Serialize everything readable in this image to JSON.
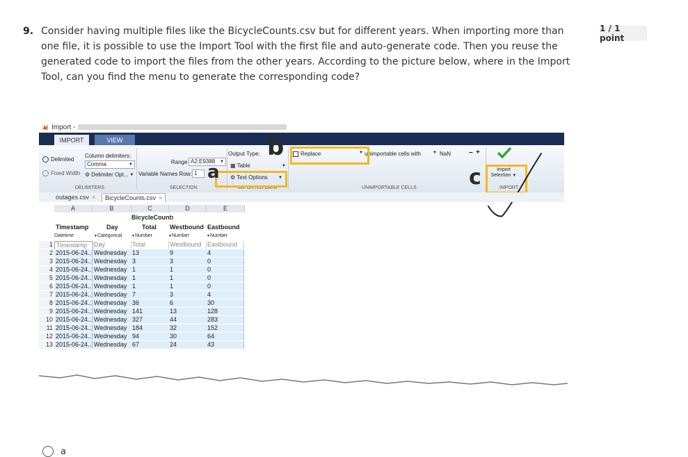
{
  "question": {
    "number": "9.",
    "text": "Consider having multiple files like the BicycleCounts.csv but for different years. When importing more than one file, it is possible to use the Import Tool with the first file and auto-generate code. Then you reuse the generated code to import the files from the other years. According to the picture below, where in the Import Tool, can you find the menu to generate the corresponding code?",
    "points": "1 / 1 point"
  },
  "screenshot": {
    "window_title": "Import -",
    "tabs": [
      "IMPORT",
      "VIEW"
    ],
    "ribbon": {
      "delimited_label": "Delimited",
      "fixed_width_label": "Fixed Width",
      "column_delimiters_label": "Column delimiters:",
      "delimiter_value": "Comma",
      "delimiter_options": "Delimiter Opt...",
      "range_label": "Range",
      "range_value": "A2:E9388",
      "variable_names_row_label": "Variable Names Row:",
      "variable_names_row_value": "1",
      "output_type_label": "Output Type:",
      "output_type_value": "Table",
      "text_options": "Text Options",
      "replace_label": "Replace",
      "unimportable_label": "unimportable cells with",
      "nan_value": "NaN",
      "import_selection": "Import Selection",
      "groups": {
        "delimiters": "DELIMITERS",
        "selection": "SELECTION",
        "imported_data": "IMPORTED DATA",
        "unimportable_cells": "UNIMPORTABLE CELLS",
        "import": "IMPORT"
      }
    },
    "annotations": {
      "a": "a",
      "b": "b",
      "c": "c"
    },
    "file_tabs": [
      "outages.csv",
      "BicycleCounts.csv"
    ],
    "grid": {
      "column_letters": [
        "A",
        "B",
        "C",
        "D",
        "E"
      ],
      "table_name": "BicycleCounts",
      "headers": [
        "Timestamp",
        "Day",
        "Total",
        "Westbound",
        "Eastbound"
      ],
      "types": [
        "Datetime",
        "Categorical",
        "Number",
        "Number",
        "Number"
      ],
      "name_row": [
        "Timestamp",
        "Day",
        "Total",
        "Westbound",
        "Eastbound"
      ],
      "rows": [
        {
          "n": "2",
          "ts": "2015-06-24...",
          "day": "Wednesday",
          "total": "13",
          "west": "9",
          "east": "4"
        },
        {
          "n": "3",
          "ts": "2015-06-24...",
          "day": "Wednesday",
          "total": "3",
          "west": "3",
          "east": "0"
        },
        {
          "n": "4",
          "ts": "2015-06-24...",
          "day": "Wednesday",
          "total": "1",
          "west": "1",
          "east": "0"
        },
        {
          "n": "5",
          "ts": "2015-06-24...",
          "day": "Wednesday",
          "total": "1",
          "west": "1",
          "east": "0"
        },
        {
          "n": "6",
          "ts": "2015-06-24...",
          "day": "Wednesday",
          "total": "1",
          "west": "1",
          "east": "0"
        },
        {
          "n": "7",
          "ts": "2015-06-24...",
          "day": "Wednesday",
          "total": "7",
          "west": "3",
          "east": "4"
        },
        {
          "n": "8",
          "ts": "2015-06-24...",
          "day": "Wednesday",
          "total": "36",
          "west": "6",
          "east": "30"
        },
        {
          "n": "9",
          "ts": "2015-06-24...",
          "day": "Wednesday",
          "total": "141",
          "west": "13",
          "east": "128"
        },
        {
          "n": "10",
          "ts": "2015-06-24...",
          "day": "Wednesday",
          "total": "327",
          "west": "44",
          "east": "283"
        },
        {
          "n": "11",
          "ts": "2015-06-24...",
          "day": "Wednesday",
          "total": "184",
          "west": "32",
          "east": "152"
        },
        {
          "n": "12",
          "ts": "2015-06-24...",
          "day": "Wednesday",
          "total": "94",
          "west": "30",
          "east": "64"
        },
        {
          "n": "13",
          "ts": "2015-06-24...",
          "day": "Wednesday",
          "total": "67",
          "west": "24",
          "east": "43"
        }
      ]
    }
  },
  "answer_option": {
    "label": "a"
  },
  "colors": {
    "highlight": "#f4b81c",
    "ribbon_dark": "#1c2d53",
    "grid_cell": "#dfeefb"
  }
}
